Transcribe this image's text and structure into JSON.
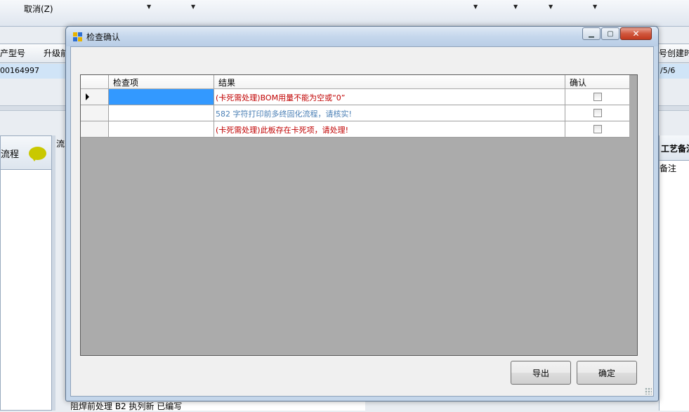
{
  "background": {
    "toolbar": {
      "cancel_label": "取消(Z)"
    },
    "grid": {
      "col_product_model": "产型号",
      "col_upgrade": "升级前",
      "col_created": "号创建时",
      "row_id": "00164997",
      "row_date": "/5/6"
    },
    "left_panel": {
      "title": "流程"
    },
    "middle_panel": {
      "title": "流",
      "bottom_row_text": "阻焊前处理   B2     执列新           已编写"
    },
    "right_panel": {
      "title": "工艺备注",
      "sub": "备注"
    }
  },
  "dialog": {
    "title": "检查确认",
    "grid": {
      "columns": [
        "检查项",
        "结果",
        "确认"
      ],
      "rows": [
        {
          "item": "",
          "result": "(卡死需处理)BOM用量不能为空或“0”",
          "result_color": "#c00000",
          "confirmed": false,
          "selected": true
        },
        {
          "item": "",
          "result": "582 字符打印前多终固化流程，请核实!",
          "result_color": "#4a7fb5",
          "confirmed": false,
          "selected": false
        },
        {
          "item": "",
          "result": "(卡死需处理)此板存在卡死项，请处理!",
          "result_color": "#c00000",
          "confirmed": false,
          "selected": false
        }
      ]
    },
    "buttons": {
      "export": "导出",
      "ok": "确定"
    }
  },
  "colors": {
    "selected_cell": "#3399ff",
    "close_button": "#c23a1f",
    "grid_background": "#ababab"
  }
}
